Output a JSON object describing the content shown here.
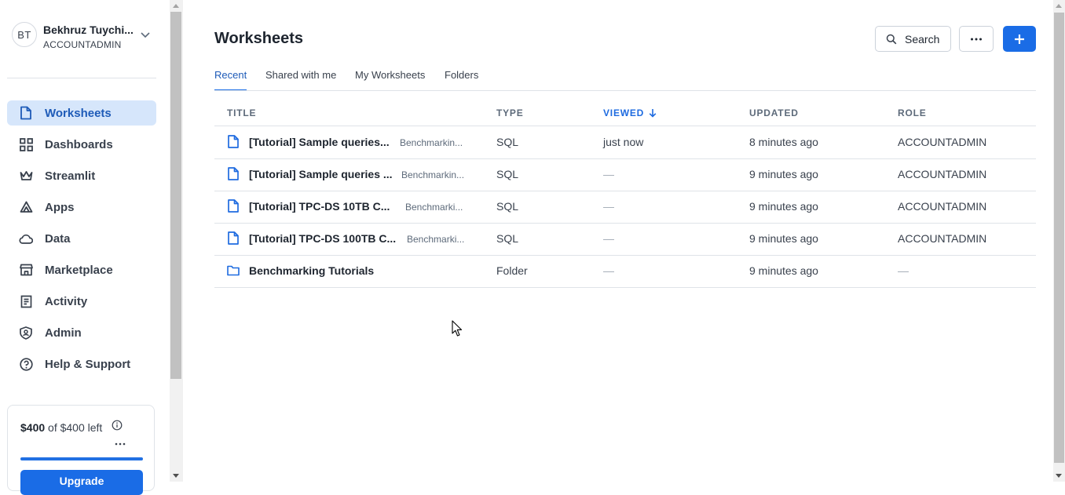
{
  "user": {
    "initials": "BT",
    "name": "Bekhruz Tuychi...",
    "role": "ACCOUNTADMIN"
  },
  "nav": [
    {
      "label": "Worksheets",
      "icon": "file-icon",
      "active": true
    },
    {
      "label": "Dashboards",
      "icon": "grid-icon"
    },
    {
      "label": "Streamlit",
      "icon": "crown-icon"
    },
    {
      "label": "Apps",
      "icon": "apps-icon"
    },
    {
      "label": "Data",
      "icon": "cloud-icon"
    },
    {
      "label": "Marketplace",
      "icon": "store-icon"
    },
    {
      "label": "Activity",
      "icon": "activity-icon"
    },
    {
      "label": "Admin",
      "icon": "shield-icon"
    },
    {
      "label": "Help & Support",
      "icon": "help-icon"
    }
  ],
  "credit": {
    "amount": "$400",
    "rest": " of $400 left",
    "used_fraction": 1.0,
    "upgrade_label": "Upgrade"
  },
  "page": {
    "title": "Worksheets",
    "search_label": "Search"
  },
  "tabs": [
    "Recent",
    "Shared with me",
    "My Worksheets",
    "Folders"
  ],
  "columns": {
    "title": "TITLE",
    "type": "TYPE",
    "viewed": "VIEWED",
    "updated": "UPDATED",
    "role": "ROLE"
  },
  "rows": [
    {
      "kind": "file",
      "title": "[Tutorial] Sample queries...",
      "location": "Benchmarkin...",
      "type": "SQL",
      "viewed": "just now",
      "updated": "8 minutes ago",
      "role": "ACCOUNTADMIN"
    },
    {
      "kind": "file",
      "title": "[Tutorial] Sample queries ...",
      "location": "Benchmarkin...",
      "type": "SQL",
      "viewed": "—",
      "updated": "9 minutes ago",
      "role": "ACCOUNTADMIN"
    },
    {
      "kind": "file",
      "title": "[Tutorial] TPC-DS 10TB C...",
      "location": "Benchmarki...",
      "type": "SQL",
      "viewed": "—",
      "updated": "9 minutes ago",
      "role": "ACCOUNTADMIN"
    },
    {
      "kind": "file",
      "title": "[Tutorial] TPC-DS 100TB C...",
      "location": "Benchmarki...",
      "type": "SQL",
      "viewed": "—",
      "updated": "9 minutes ago",
      "role": "ACCOUNTADMIN"
    },
    {
      "kind": "folder",
      "title": "Benchmarking Tutorials",
      "location": "",
      "type": "Folder",
      "viewed": "—",
      "updated": "9 minutes ago",
      "role": "—"
    }
  ],
  "colors": {
    "accent": "#1a6ce6",
    "active_bg": "#d6e6fb",
    "active_text": "#1e5bb8"
  }
}
